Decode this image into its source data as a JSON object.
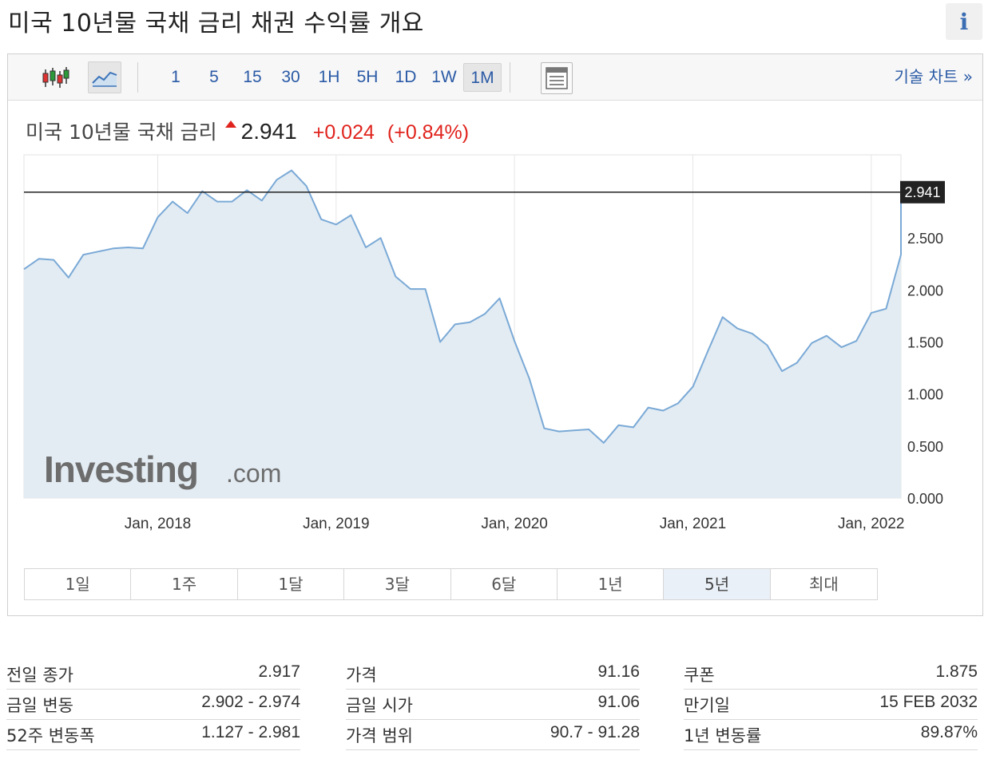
{
  "page": {
    "title": "미국 10년물 국채 금리  채권 수익률 개요",
    "info_icon": "i"
  },
  "toolbar": {
    "icons": [
      "candlestick-icon",
      "line-chart-icon",
      "table-view-icon"
    ],
    "intervals": [
      "1",
      "5",
      "15",
      "30",
      "1H",
      "5H",
      "1D",
      "1W",
      "1M"
    ],
    "active_interval": "1M",
    "tech_chart_link": "기술 차트 »"
  },
  "quote": {
    "name": "미국 10년물 국채 금리",
    "last": "2.941",
    "change": "+0.024",
    "change_pct": "(+0.84%)",
    "up_color": "#e0231d"
  },
  "watermark": {
    "brand": "Investing",
    "suffix": ".com"
  },
  "chart_data": {
    "type": "area",
    "title": "",
    "xlabel": "",
    "ylabel": "",
    "x_ticks": [
      "Jan, 2018",
      "Jan, 2019",
      "Jan, 2020",
      "Jan, 2021",
      "Jan, 2022"
    ],
    "y_ticks": [
      "0.000",
      "0.500",
      "1.000",
      "1.500",
      "2.000",
      "2.500"
    ],
    "ylim": [
      0,
      3.3
    ],
    "x_range": [
      "2017-04",
      "2022-03"
    ],
    "current_value_label": "2.941",
    "current_value": 2.941,
    "grid": "vertical at year ticks",
    "line_color": "#7aa9d6",
    "fill_color": "#e3ecf3",
    "series": [
      {
        "x": [
          "2017-04",
          "2017-05",
          "2017-06",
          "2017-07",
          "2017-08",
          "2017-09",
          "2017-10",
          "2017-11",
          "2017-12",
          "2018-01",
          "2018-02",
          "2018-03",
          "2018-04",
          "2018-05",
          "2018-06",
          "2018-07",
          "2018-08",
          "2018-09",
          "2018-10",
          "2018-11",
          "2018-12",
          "2019-01",
          "2019-02",
          "2019-03",
          "2019-04",
          "2019-05",
          "2019-06",
          "2019-07",
          "2019-08",
          "2019-09",
          "2019-10",
          "2019-11",
          "2019-12",
          "2020-01",
          "2020-02",
          "2020-03",
          "2020-04",
          "2020-05",
          "2020-06",
          "2020-07",
          "2020-08",
          "2020-09",
          "2020-10",
          "2020-11",
          "2020-12",
          "2021-01",
          "2021-02",
          "2021-03",
          "2021-04",
          "2021-05",
          "2021-06",
          "2021-07",
          "2021-08",
          "2021-09",
          "2021-10",
          "2021-11",
          "2021-12",
          "2022-01",
          "2022-02",
          "2022-03"
        ],
        "values": [
          2.2,
          2.3,
          2.29,
          2.12,
          2.34,
          2.37,
          2.4,
          2.41,
          2.4,
          2.7,
          2.85,
          2.74,
          2.95,
          2.85,
          2.85,
          2.96,
          2.86,
          3.06,
          3.15,
          3.0,
          2.68,
          2.63,
          2.72,
          2.41,
          2.5,
          2.13,
          2.01,
          2.01,
          1.5,
          1.67,
          1.69,
          1.77,
          1.92,
          1.51,
          1.15,
          0.67,
          0.64,
          0.65,
          0.66,
          0.53,
          0.7,
          0.68,
          0.87,
          0.84,
          0.91,
          1.07,
          1.41,
          1.74,
          1.63,
          1.58,
          1.47,
          1.22,
          1.3,
          1.49,
          1.56,
          1.45,
          1.51,
          1.78,
          1.82,
          2.34
        ]
      }
    ]
  },
  "periods": {
    "items": [
      "1일",
      "1주",
      "1달",
      "3달",
      "6달",
      "1년",
      "5년",
      "최대"
    ],
    "active": "5년"
  },
  "stats": {
    "col1": [
      {
        "label": "전일 종가",
        "value": "2.917"
      },
      {
        "label": "금일 변동",
        "value": "2.902 - 2.974"
      },
      {
        "label": "52주 변동폭",
        "value": "1.127 - 2.981"
      }
    ],
    "col2": [
      {
        "label": "가격",
        "value": "91.16"
      },
      {
        "label": "금일 시가",
        "value": "91.06"
      },
      {
        "label": "가격 범위",
        "value": "90.7 - 91.28"
      }
    ],
    "col3": [
      {
        "label": "쿠폰",
        "value": "1.875"
      },
      {
        "label": "만기일",
        "value": "15 FEB 2032"
      },
      {
        "label": "1년 변동률",
        "value": "89.87%"
      }
    ]
  }
}
